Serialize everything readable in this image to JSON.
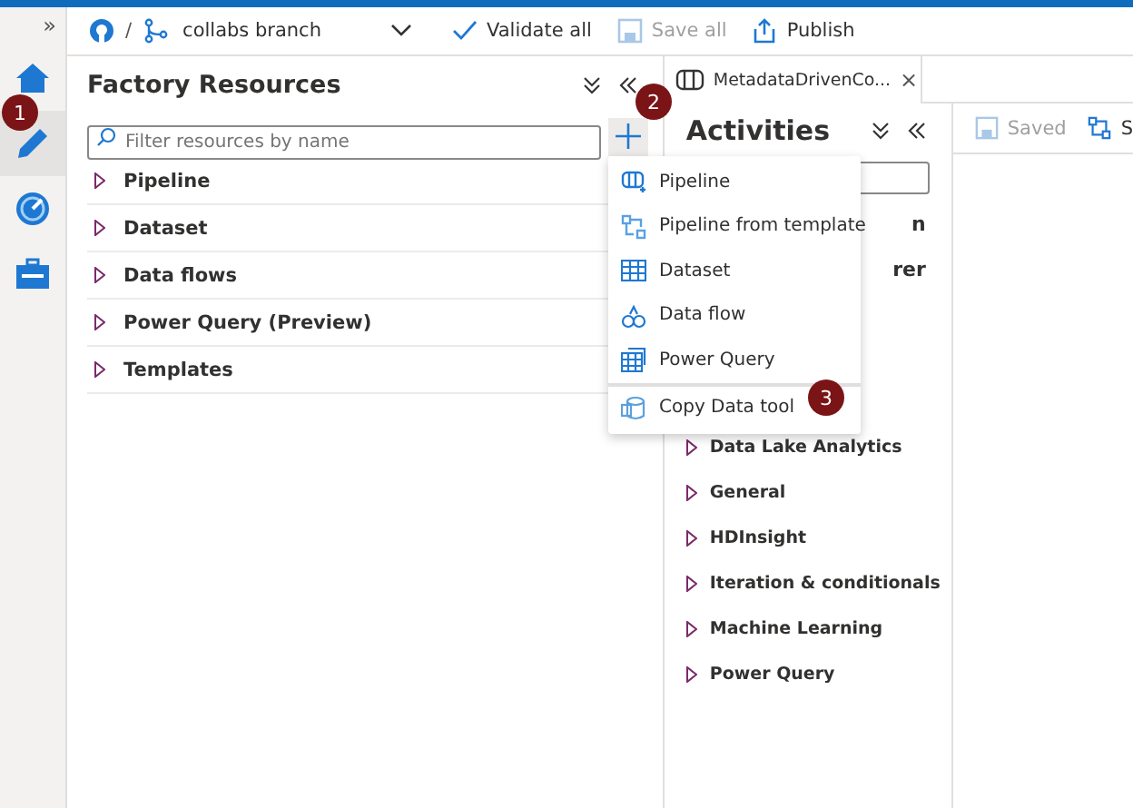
{
  "rail": {
    "toggle": "»",
    "items": [
      {
        "kind": "home",
        "selected": false
      },
      {
        "kind": "author",
        "selected": true
      },
      {
        "kind": "monitor",
        "selected": false
      },
      {
        "kind": "manage",
        "selected": false
      }
    ]
  },
  "toolbar": {
    "separator": "/",
    "branch": "collabs branch",
    "actions": [
      {
        "kind": "validate",
        "label": "Validate all",
        "disabled": false
      },
      {
        "kind": "save",
        "label": "Save all",
        "disabled": true
      },
      {
        "kind": "publish",
        "label": "Publish",
        "disabled": false
      }
    ]
  },
  "factory_resources": {
    "title": "Factory Resources",
    "search": {
      "placeholder": "Filter resources by name"
    },
    "items": [
      "Pipeline",
      "Dataset",
      "Data flows",
      "Power Query (Preview)",
      "Templates"
    ]
  },
  "menu": {
    "items": [
      {
        "kind": "pipeline",
        "label": "Pipeline"
      },
      {
        "kind": "template",
        "label": "Pipeline from template"
      },
      {
        "kind": "dataset",
        "label": "Dataset"
      },
      {
        "kind": "dataflow",
        "label": "Data flow"
      },
      {
        "kind": "powerquery",
        "label": "Power Query"
      },
      {
        "kind": "copy",
        "label": "Copy Data tool"
      }
    ]
  },
  "tab": {
    "title": "MetadataDrivenCo...",
    "close": "×"
  },
  "activities": {
    "title": "Activities",
    "partial_items": [
      "n",
      "rer"
    ],
    "items": [
      "Data Lake Analytics",
      "General",
      "HDInsight",
      "Iteration & conditionals",
      "Machine Learning",
      "Power Query"
    ]
  },
  "canvas_toolbar": {
    "saved": "Saved",
    "next": "S"
  },
  "badges": [
    "1",
    "2",
    "3"
  ]
}
